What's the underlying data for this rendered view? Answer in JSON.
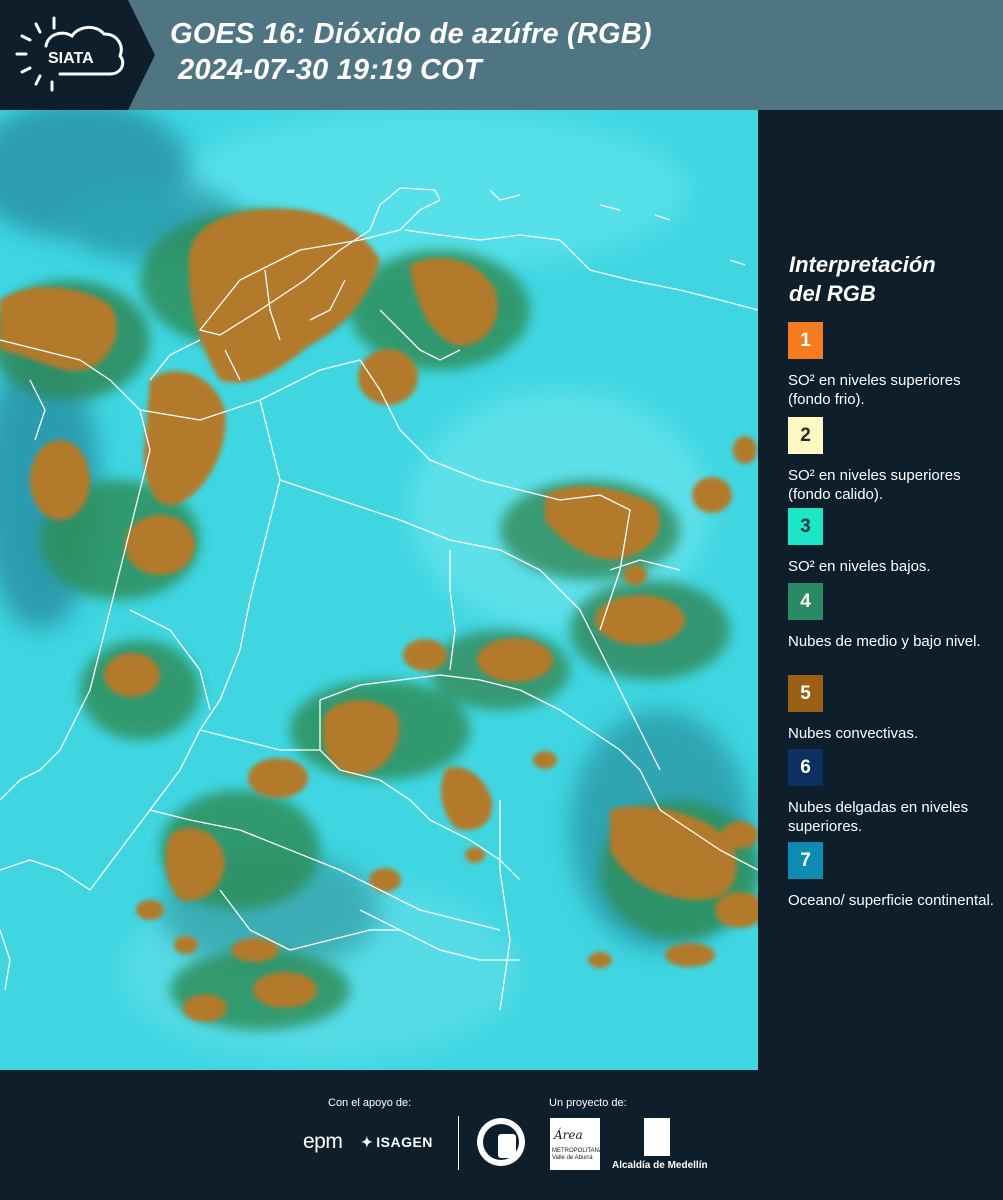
{
  "header": {
    "logo_text": "SIATA",
    "title_line1": "GOES 16: Dióxido de azúfre (RGB)",
    "title_line2": "2024-07-30 19:19 COT"
  },
  "legend": {
    "title_line1": "Interpretación",
    "title_line2": "del RGB",
    "items": [
      {
        "number": "1",
        "text": "SO² en niveles superiores (fondo frio).",
        "color": "#f47b20",
        "numcolor": "#ffffff"
      },
      {
        "number": "2",
        "text": "SO² en niveles superiores (fondo calido).",
        "color": "#fff8c2",
        "numcolor": "#2a2a2a"
      },
      {
        "number": "3",
        "text": "SO² en niveles bajos.",
        "color": "#1de6c8",
        "numcolor": "#1e3a3a"
      },
      {
        "number": "4",
        "text": "Nubes de medio y bajo nivel.",
        "color": "#2a8a63",
        "numcolor": "#ffffff"
      },
      {
        "number": "5",
        "text": "Nubes convectivas.",
        "color": "#9b5f16",
        "numcolor": "#ffffff"
      },
      {
        "number": "6",
        "text": "Nubes delgadas en niveles superiores.",
        "color": "#0d3062",
        "numcolor": "#ffffff"
      },
      {
        "number": "7",
        "text": "Oceano/ superficie continental.",
        "color": "#0d8bb2",
        "numcolor": "#ffffff"
      }
    ]
  },
  "footer": {
    "support_label": "Con el apoyo de:",
    "project_label": "Un proyecto de:",
    "epm": "epm",
    "isagen": "ISAGEN",
    "area_logo_text": "Área",
    "area_logo_sub": "METROPOLITANA Valle de Aburrá",
    "alcaldia": "Alcaldía de Medellín"
  },
  "colors": {
    "header_bg": "#4f7482",
    "panel_bg": "#0e1e2b",
    "map_background": "#3fd6e2",
    "convective_cloud": "#b27a2a",
    "mid_low_cloud": "#2f8f5c"
  }
}
